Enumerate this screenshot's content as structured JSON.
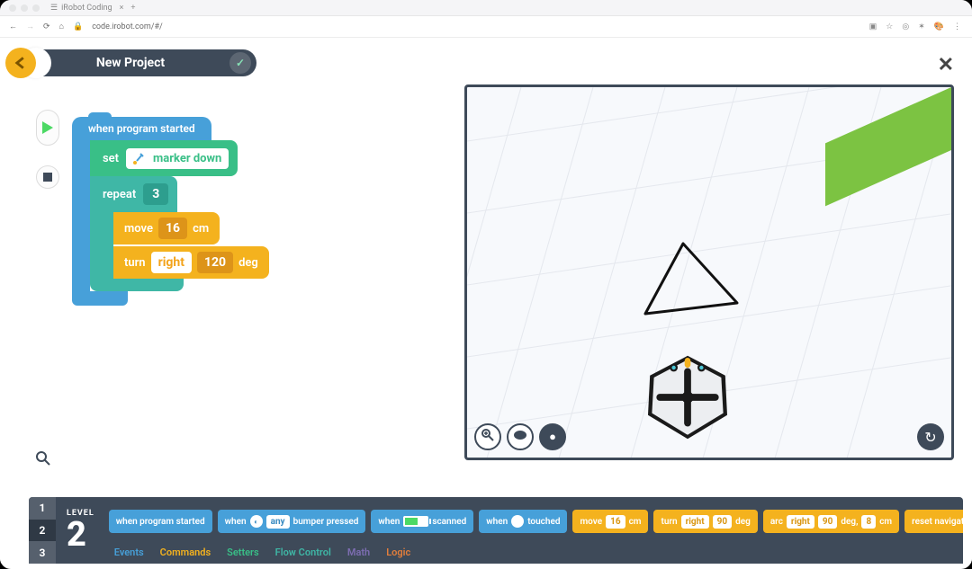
{
  "browser": {
    "tab_title": "iRobot Coding",
    "url": "code.irobot.com/#/"
  },
  "header": {
    "title": "New Project",
    "level_badge": "✓"
  },
  "controls": {
    "play": "▶",
    "stop": "■"
  },
  "program": {
    "when_label": "when program started",
    "set_label": "set",
    "marker_label": "marker down",
    "repeat_label": "repeat",
    "repeat_count": "3",
    "move_label": "move",
    "move_value": "16",
    "move_unit": "cm",
    "turn_label": "turn",
    "turn_dir": "right",
    "turn_value": "120",
    "turn_unit": "deg"
  },
  "palette": {
    "level_label": "LEVEL",
    "levels": [
      "1",
      "2",
      "3"
    ],
    "current_level": "2",
    "blocks": [
      {
        "type": "event",
        "label": "when program started"
      },
      {
        "type": "event",
        "label_prefix": "when",
        "param": "any",
        "label_suffix": "bumper pressed"
      },
      {
        "type": "event",
        "label_prefix": "when",
        "icon": "battery",
        "label_suffix": "scanned"
      },
      {
        "type": "event",
        "label_prefix": "when",
        "icon": "net",
        "label_suffix": "touched"
      },
      {
        "type": "cmd",
        "label": "move",
        "p1": "16",
        "u1": "cm"
      },
      {
        "type": "cmd",
        "label": "turn",
        "p1": "right",
        "p2": "90",
        "u1": "deg"
      },
      {
        "type": "cmd",
        "label": "arc",
        "p1": "right",
        "p2": "90",
        "u1": "deg,",
        "p3": "8",
        "u2": "cm"
      },
      {
        "type": "cmd",
        "label": "reset navigation"
      }
    ],
    "categories": [
      {
        "name": "Events",
        "color": "#47a0d9"
      },
      {
        "name": "Commands",
        "color": "#f4b21e"
      },
      {
        "name": "Setters",
        "color": "#39bf87"
      },
      {
        "name": "Flow Control",
        "color": "#3fb7a6"
      },
      {
        "name": "Math",
        "color": "#7d6db1"
      },
      {
        "name": "Logic",
        "color": "#e37e3b"
      }
    ]
  }
}
